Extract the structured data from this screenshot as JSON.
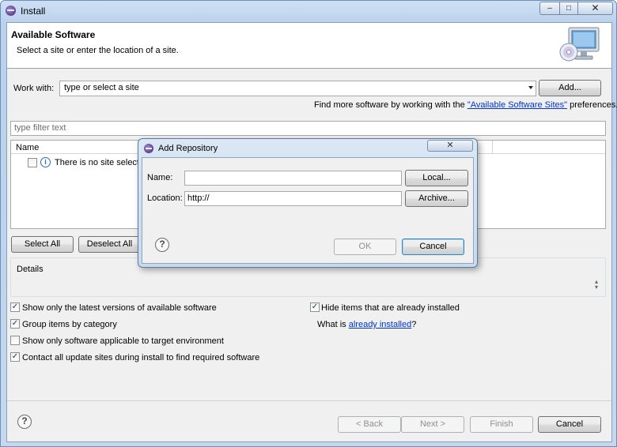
{
  "window": {
    "title": "Install",
    "minimize": "–",
    "maximize": "□",
    "close": "✕"
  },
  "header": {
    "title": "Available Software",
    "description": "Select a site or enter the location of a site."
  },
  "work_with": {
    "label": "Work with:",
    "value": "type or select a site",
    "add_button": "Add..."
  },
  "find_more": {
    "prefix": "Find more software by working with the ",
    "link": "\"Available Software Sites\"",
    "suffix": " preferences."
  },
  "filter": {
    "placeholder": "type filter text"
  },
  "tree": {
    "column_name": "Name",
    "rows": [
      {
        "label": "There is no site selected."
      }
    ]
  },
  "buttons": {
    "select_all": "Select All",
    "deselect_all": "Deselect All"
  },
  "details": {
    "label": "Details"
  },
  "options": {
    "latest_versions": "Show only the latest versions of available software",
    "group_by_category": "Group items by category",
    "target_env": "Show only software applicable to target environment",
    "contact_sites": "Contact all update sites during install to find required software",
    "hide_installed": "Hide items that are already installed",
    "what_is_prefix": "What is ",
    "what_is_link": "already installed",
    "what_is_suffix": "?"
  },
  "checkbox_states": {
    "latest_versions": true,
    "group_by_category": true,
    "target_env": false,
    "contact_sites": true,
    "hide_installed": true,
    "tree_row": false
  },
  "footer": {
    "back": "< Back",
    "next": "Next >",
    "finish": "Finish",
    "cancel": "Cancel"
  },
  "dialog": {
    "title": "Add Repository",
    "close": "✕",
    "name_label": "Name:",
    "name_value": "",
    "location_label": "Location:",
    "location_value": "http://",
    "local_button": "Local...",
    "archive_button": "Archive...",
    "ok": "OK",
    "cancel": "Cancel"
  },
  "icons": {
    "help": "?",
    "info": "i",
    "check": "✓"
  }
}
